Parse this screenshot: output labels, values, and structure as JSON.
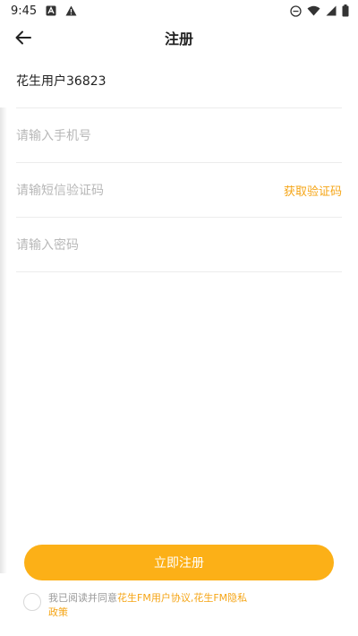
{
  "status_bar": {
    "time": "9:45",
    "left_icons": [
      "a-badge-icon",
      "warning-icon"
    ],
    "right_icons": [
      "do-not-disturb-icon",
      "wifi-icon",
      "signal-icon",
      "battery-icon"
    ]
  },
  "header": {
    "title": "注册",
    "back_icon": "arrow-left-icon"
  },
  "form": {
    "nickname_value": "花生用户36823",
    "phone_placeholder": "请输入手机号",
    "sms_code_placeholder": "请输短信验证码",
    "get_code_label": "获取验证码",
    "password_placeholder": "请输入密码"
  },
  "register_button": {
    "label": "立即注册"
  },
  "agreement": {
    "prefix": "我已阅读并同意",
    "user_agreement_link": "花生FM用户协议",
    "separator": ",",
    "privacy_policy_link": "花生FM隐私政策"
  },
  "colors": {
    "accent": "#fcb017",
    "link": "#f5a516",
    "placeholder": "#b8b8b8"
  }
}
